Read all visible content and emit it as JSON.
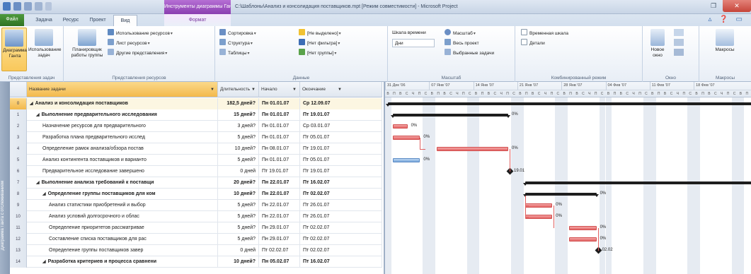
{
  "window": {
    "title": "C:\\Шаблоны\\Анализ и консолидация поставщиков.mpt [Режим совместимости] - Microsoft Project",
    "context_tab_title": "Инструменты диаграммы Ганта",
    "close_glyph": "✕",
    "maximize_glyph": "❐"
  },
  "tabs": {
    "file": "Файл",
    "task": "Задача",
    "resource": "Ресурс",
    "project": "Проект",
    "view": "Вид",
    "format": "Формат"
  },
  "help_glyphs": "▵ ❓ ▭",
  "ribbon": {
    "groups": {
      "task_views": "Представления задач",
      "resource_views": "Представления ресурсов",
      "data": "Данные",
      "zoom": "Масштаб",
      "split_view": "Комбинированный режим",
      "window": "Окно",
      "macros": "Макросы"
    },
    "gantt_chart": "Диаграмма Ганта",
    "task_usage": "Использование задач",
    "team_planner": "Планировщик работы группы",
    "resource_usage": "Использование ресурсов",
    "resource_sheet": "Лист ресурсов",
    "other_views": "Другие представления",
    "sort": "Сортировка",
    "outline": "Структура",
    "tables": "Таблицы",
    "highlight": "[Не выделено]",
    "filter": "[Нет фильтра]",
    "group": "[Нет группы]",
    "timescale": "Шкала времени",
    "timescale_value": "Дни",
    "zoom": "Масштаб",
    "entire_project": "Весь проект",
    "selected_tasks": "Выбранные задачи",
    "timeline": "Временная шкала",
    "details": "Детали",
    "new_window": "Новое окно",
    "macros": "Макросы"
  },
  "table": {
    "headers": {
      "name": "Название задачи",
      "duration": "Длительность",
      "start": "Начало",
      "finish": "Окончание"
    },
    "rows": [
      {
        "id": "0",
        "name": "Анализ и консолидация поставщиков",
        "duration": "182,5 дней?",
        "start": "Пн 01.01.07",
        "finish": "Ср 12.09.07",
        "summary": true,
        "level": 0,
        "highlight": true
      },
      {
        "id": "1",
        "name": "Выполнение предварительного исследования",
        "duration": "15 дней?",
        "start": "Пн 01.01.07",
        "finish": "Пт 19.01.07",
        "summary": true,
        "level": 1
      },
      {
        "id": "2",
        "name": "Назначение ресурсов для предварительного",
        "duration": "3 дней?",
        "start": "Пн 01.01.07",
        "finish": "Ср 03.01.07",
        "summary": false,
        "level": 2
      },
      {
        "id": "3",
        "name": "Разработка плана предварительного исслед",
        "duration": "5 дней?",
        "start": "Пн 01.01.07",
        "finish": "Пт 05.01.07",
        "summary": false,
        "level": 2
      },
      {
        "id": "4",
        "name": "Определение рамок анализа/обзора постав",
        "duration": "10 дней?",
        "start": "Пн 08.01.07",
        "finish": "Пт 19.01.07",
        "summary": false,
        "level": 2
      },
      {
        "id": "5",
        "name": "Анализ контингента поставщиков и варианто",
        "duration": "5 дней?",
        "start": "Пн 01.01.07",
        "finish": "Пт 05.01.07",
        "summary": false,
        "level": 2
      },
      {
        "id": "6",
        "name": "Предварительное исследование завершено",
        "duration": "0 дней",
        "start": "Пт 19.01.07",
        "finish": "Пт 19.01.07",
        "summary": false,
        "level": 2
      },
      {
        "id": "7",
        "name": "Выполнение анализа требований к поставщи",
        "duration": "20 дней?",
        "start": "Пн 22.01.07",
        "finish": "Пт 16.02.07",
        "summary": true,
        "level": 1
      },
      {
        "id": "8",
        "name": "Определение группы поставщиков для ком",
        "duration": "10 дней?",
        "start": "Пн 22.01.07",
        "finish": "Пт 02.02.07",
        "summary": true,
        "level": 2
      },
      {
        "id": "9",
        "name": "Анализ статистики приобретений и выбор",
        "duration": "5 дней?",
        "start": "Пн 22.01.07",
        "finish": "Пт 26.01.07",
        "summary": false,
        "level": 3
      },
      {
        "id": "10",
        "name": "Анализ условий долгосрочного и облас",
        "duration": "5 дней?",
        "start": "Пн 22.01.07",
        "finish": "Пт 26.01.07",
        "summary": false,
        "level": 3
      },
      {
        "id": "11",
        "name": "Определение приоритетов рассматривае",
        "duration": "5 дней?",
        "start": "Пн 29.01.07",
        "finish": "Пт 02.02.07",
        "summary": false,
        "level": 3
      },
      {
        "id": "12",
        "name": "Составление списка поставщиков для рас",
        "duration": "5 дней?",
        "start": "Пн 29.01.07",
        "finish": "Пт 02.02.07",
        "summary": false,
        "level": 3
      },
      {
        "id": "13",
        "name": "Определение группы поставщиков завер",
        "duration": "0 дней",
        "start": "Пт 02.02.07",
        "finish": "Пт 02.02.07",
        "summary": false,
        "level": 3
      },
      {
        "id": "14",
        "name": "Разработка критериев и процесса сравнени",
        "duration": "10 дней?",
        "start": "Пн 05.02.07",
        "finish": "Пт 16.02.07",
        "summary": true,
        "level": 2
      }
    ]
  },
  "gantt": {
    "weeks": [
      "31 Дек '06",
      "07 Янв '07",
      "14 Янв '07",
      "21 Янв '07",
      "28 Янв '07",
      "04 Фев '07",
      "11 Фев '07",
      "18 Фев '07"
    ],
    "day_letters": [
      "В",
      "П",
      "В",
      "С",
      "Ч",
      "П",
      "С"
    ],
    "bars": [
      {
        "row": 1,
        "pct": "0%"
      },
      {
        "row": 2,
        "pct": "0%"
      },
      {
        "row": 3,
        "pct": "0%"
      },
      {
        "row": 4,
        "pct": "0%"
      },
      {
        "row": 5,
        "pct": "0%"
      },
      {
        "row": 6,
        "milestone_label": "19.01"
      },
      {
        "row": 7,
        "pct": ""
      },
      {
        "row": 8,
        "pct": "0%"
      },
      {
        "row": 9,
        "pct": "0%"
      },
      {
        "row": 10,
        "pct": "0%"
      },
      {
        "row": 11,
        "pct": "0%"
      },
      {
        "row": 12,
        "pct": "0%"
      },
      {
        "row": 13,
        "milestone_label": "02.02"
      }
    ]
  },
  "viewbar_label": "Диаграмма Ганта с отслеживанием",
  "colors": {
    "file_tab": "#2f7322",
    "context_tab": "#8a3db0",
    "task_bar": "#e36464",
    "critical_bar": "#7aa8dc",
    "summary_bar": "#1e1e1e",
    "selected_header": "#f3b94b"
  }
}
